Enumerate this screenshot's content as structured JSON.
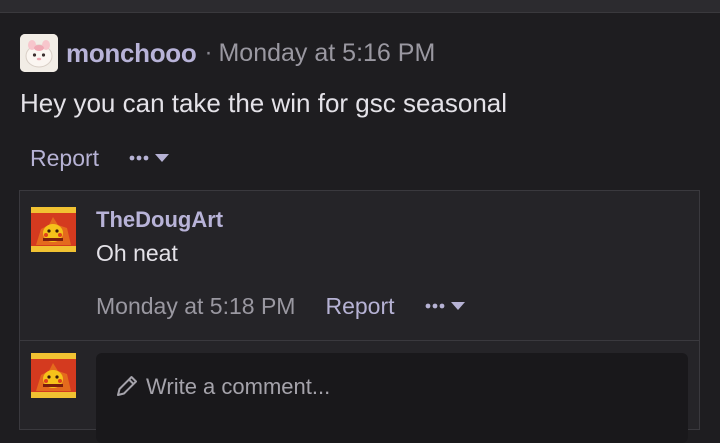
{
  "post": {
    "author": "monchooo",
    "separator": "·",
    "time": "Monday at 5:16 PM",
    "body": "Hey you can take the win for gsc seasonal",
    "actions": {
      "report_label": "Report",
      "more_icon": "ellipsis-icon",
      "dropdown_icon": "caret-down-icon"
    }
  },
  "comment": {
    "author": "TheDougArt",
    "body": "Oh neat",
    "time": "Monday at 5:18 PM",
    "actions": {
      "report_label": "Report",
      "more_icon": "ellipsis-icon",
      "dropdown_icon": "caret-down-icon"
    }
  },
  "reply": {
    "placeholder": "Write a comment...",
    "icon": "pencil-icon"
  },
  "colors": {
    "background": "#1e1d20",
    "username": "#b8b3d8",
    "link": "#b6b2d4",
    "text": "#e4e2e8",
    "muted": "#9a98a1"
  }
}
